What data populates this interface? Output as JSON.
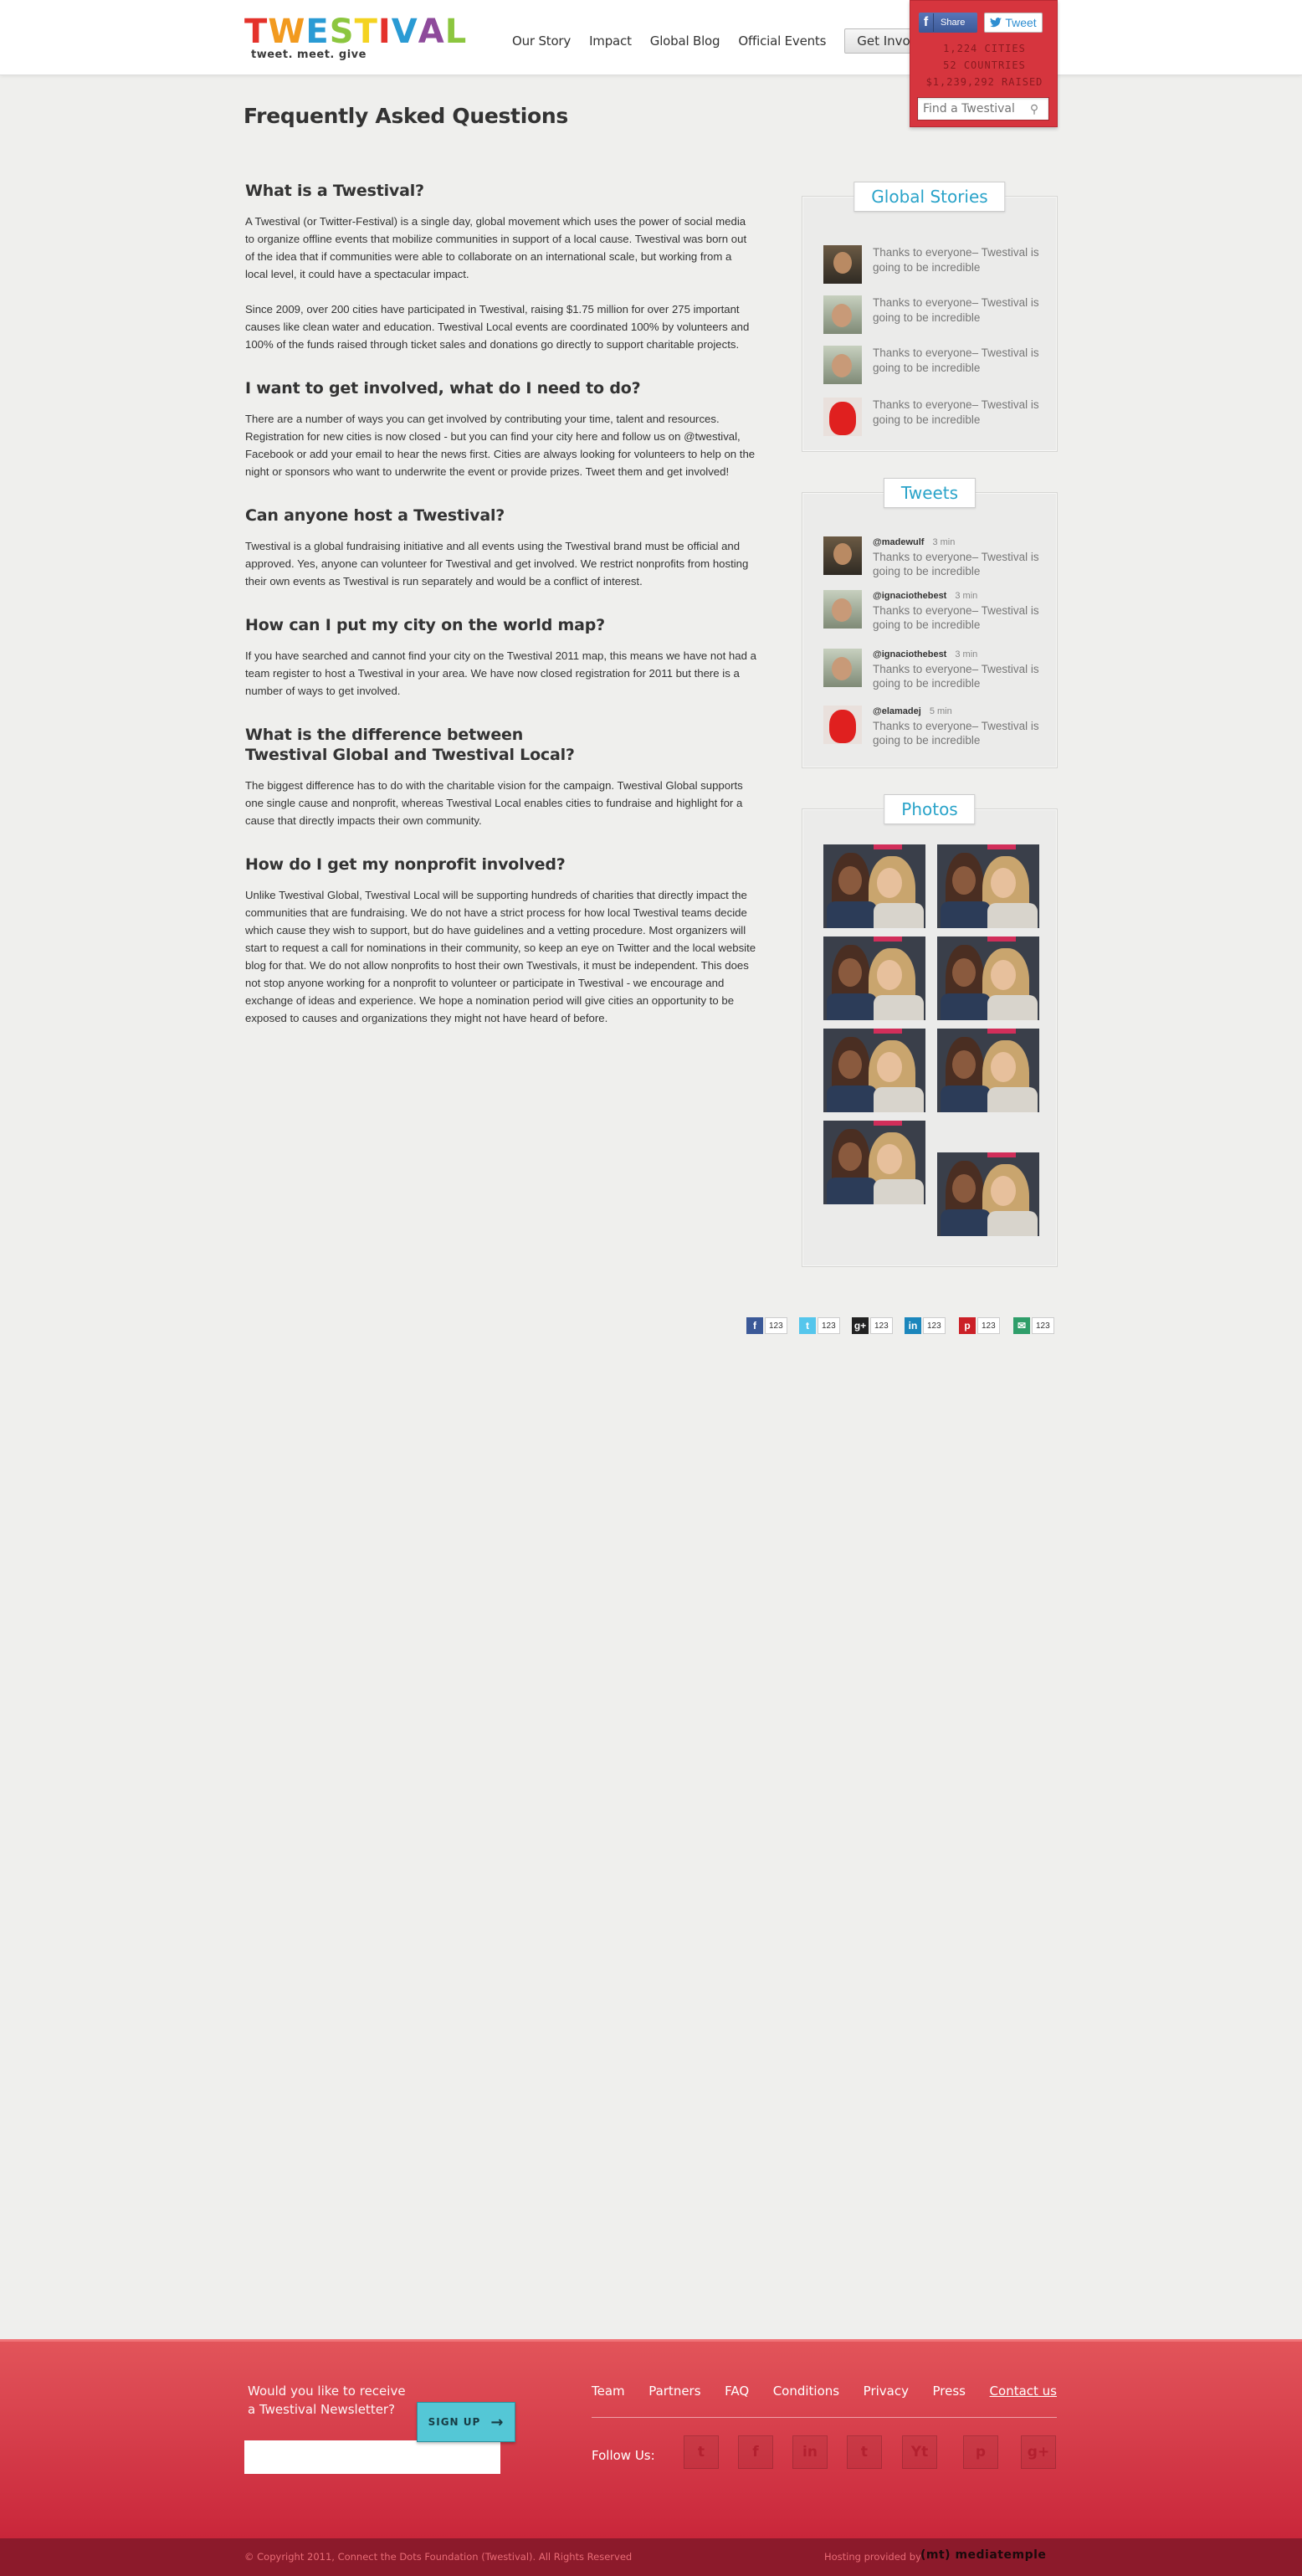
{
  "brand": {
    "logo_letters": [
      {
        "ch": "T",
        "color": "#e4322b"
      },
      {
        "ch": "W",
        "color": "#f29a1f"
      },
      {
        "ch": "E",
        "color": "#2a9bd4"
      },
      {
        "ch": "S",
        "color": "#8cc63f"
      },
      {
        "ch": "T",
        "color": "#f4d321"
      },
      {
        "ch": "I",
        "color": "#e4322b"
      },
      {
        "ch": "V",
        "color": "#2a9bd4"
      },
      {
        "ch": "A",
        "color": "#8e4a9b"
      },
      {
        "ch": "L",
        "color": "#8cc63f"
      }
    ],
    "tagline": "tweet. meet. give"
  },
  "nav": {
    "items": [
      "Our Story",
      "Impact",
      "Global Blog",
      "Official Events"
    ],
    "cta": "Get Involved"
  },
  "header_box": {
    "share_label": "Share",
    "tweet_label": "Tweet",
    "stats": [
      "1,224 CITIES",
      "52 COUNTRIES",
      "$1,239,292 RAISED"
    ],
    "search_placeholder": "Find a Twestival"
  },
  "page_title": "Frequently Asked Questions",
  "faq": [
    {
      "q": "What is a Twestival?",
      "a": [
        "A Twestival (or Twitter-Festival) is a single day, global movement which uses the power of social media to organize offline events that mobilize communities in support of a local cause. Twestival was born out of the idea that if communities were able to collaborate on an international scale, but working from a local level, it could have a spectacular impact.",
        "Since 2009, over 200 cities have participated in Twestival, raising $1.75 million for over 275 important causes like clean water and education. Twestival Local events are coordinated 100% by volunteers and 100% of the funds raised through ticket sales and donations go directly to support charitable projects."
      ]
    },
    {
      "q": "I want to get involved, what do I need to do?",
      "a": [
        "There are a number of ways you can get involved by contributing your time, talent and resources. Registration for new cities is now closed - but you can find your city here and follow us on @twestival, Facebook or add your email to hear the news first. Cities are always looking for volunteers to help on the night or sponsors who want to underwrite the event or provide prizes. Tweet them and get involved!"
      ]
    },
    {
      "q": "Can anyone host a Twestival?",
      "a": [
        "Twestival is a global fundraising initiative and all events using the Twestival brand must be official and approved. Yes, anyone can volunteer for Twestival and get involved. We restrict nonprofits from hosting their own events as Twestival is run separately and would be a conflict of interest."
      ]
    },
    {
      "q": "How can I put my city on the world map?",
      "a": [
        "If you have searched and cannot find your city on the Twestival 2011 map, this means we have not had a team register to host a Twestival in your area. We have now closed registration for 2011 but there is a number of ways to get involved."
      ]
    },
    {
      "q": "What is the difference between\nTwestival Global and Twestival Local?",
      "a": [
        "The biggest difference has to do with the charitable vision for the campaign. Twestival Global supports one single cause and nonprofit, whereas Twestival Local enables cities to fundraise and highlight for a cause that directly impacts their own community."
      ]
    },
    {
      "q": "How do I get my nonprofit involved?",
      "a": [
        "Unlike Twestival Global, Twestival Local will be supporting hundreds of charities that directly impact the communities that are fundraising. We do not have a strict process for how local Twestival teams decide which cause they wish to support, but do have guidelines and a vetting procedure. Most organizers will start to request a call for nominations in their community, so keep an eye on Twitter and the local website blog for that. We do not allow nonprofits to host their own Twestivals, it must be independent. This does not stop anyone working for a nonprofit to volunteer or participate in Twestival - we encourage and exchange of ideas and experience. We hope a nomination period will give cities an opportunity to be exposed to causes and organizations they might not have heard of before."
      ]
    }
  ],
  "global_stories": {
    "title": "Global Stories",
    "items": [
      {
        "text": "Thanks to everyone– Twestival is going to be incredible",
        "avatar": "dark"
      },
      {
        "text": "Thanks to everyone– Twestival is going to be incredible",
        "avatar": "mid"
      },
      {
        "text": "Thanks to everyone– Twestival is going to be incredible",
        "avatar": "mid"
      },
      {
        "text": "Thanks to everyone– Twestival is going to be incredible",
        "avatar": "red"
      }
    ]
  },
  "tweets": {
    "title": "Tweets",
    "items": [
      {
        "user": "@madewulf",
        "time": "3 min",
        "text": "Thanks to everyone– Twestival is going to be incredible",
        "avatar": "dark"
      },
      {
        "user": "@ignaciothebest",
        "time": "3 min",
        "text": "Thanks to everyone– Twestival is going to be incredible",
        "avatar": "mid"
      },
      {
        "user": "@ignaciothebest",
        "time": "3 min",
        "text": "Thanks to everyone– Twestival is going to be incredible",
        "avatar": "mid"
      },
      {
        "user": "@elamadej",
        "time": "5 min",
        "text": "Thanks to everyone– Twestival is going to be incredible",
        "avatar": "red"
      }
    ]
  },
  "photos": {
    "title": "Photos",
    "count": 8
  },
  "share_bar": [
    {
      "icon": "facebook-icon",
      "glyph": "f",
      "color": "#3b5998",
      "count": "123"
    },
    {
      "icon": "twitter-icon",
      "glyph": "t",
      "color": "#55c6ec",
      "count": "123"
    },
    {
      "icon": "googleplus-icon",
      "glyph": "g+",
      "color": "#222222",
      "count": "123"
    },
    {
      "icon": "linkedin-icon",
      "glyph": "in",
      "color": "#1b86bc",
      "count": "123"
    },
    {
      "icon": "pinterest-icon",
      "glyph": "p",
      "color": "#cb2027",
      "count": "123"
    },
    {
      "icon": "email-icon",
      "glyph": "✉",
      "color": "#2f9e6a",
      "count": "123"
    }
  ],
  "footer": {
    "newsletter_question": "Would you like to receive\na Twestival Newsletter?",
    "signup_label": "SIGN UP",
    "links": [
      "Team",
      "Partners",
      "FAQ",
      "Conditions",
      "Privacy",
      "Press",
      "Contact us"
    ],
    "follow_label": "Follow Us:",
    "social": [
      {
        "name": "twitter-icon",
        "glyph": "t"
      },
      {
        "name": "facebook-icon",
        "glyph": "f"
      },
      {
        "name": "linkedin-icon",
        "glyph": "in"
      },
      {
        "name": "tumblr-icon",
        "glyph": "t"
      },
      {
        "name": "youtube-icon",
        "glyph": "Yt"
      },
      {
        "name": "pinterest-icon",
        "glyph": "p"
      },
      {
        "name": "googleplus-icon",
        "glyph": "g+"
      }
    ],
    "copyright": "© Copyright 2011, Connect the Dots Foundation (Twestival). All Rights Reserved",
    "hosting_label": "Hosting provided by",
    "host_name": "(mt) mediatemple"
  }
}
